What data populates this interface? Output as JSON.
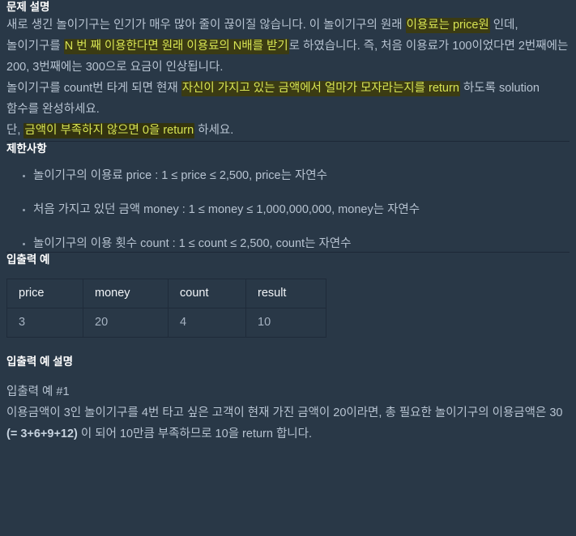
{
  "theme": {
    "background": "#293847",
    "body_text": "#b7c3d1",
    "heading_text": "#ffffff",
    "highlight_bg": "#3b3b13",
    "highlight_text": "#d7e453",
    "divider": "#1d2836",
    "table_border": "#1f2b3a",
    "table_header_text": "#f2f5f8",
    "table_cell_text": "#a5b2c1"
  },
  "problem": {
    "heading": "문제 설명",
    "intro": {
      "seg1": "새로 생긴 놀이기구는 인기가 매우 많아 줄이 끊이질 않습니다. 이 놀이기구의 원래 ",
      "hl1": "이용료는 price원",
      "seg2": " 인데, 놀이기구를 ",
      "hl2": "N 번 째 이용한다면 원래 이용료의 N배를 받기",
      "seg3": "로 하였습니다. 즉, 처음 이용료가 100이었다면 2번째에는 200, 3번째에는 300으로 요금이 인상됩니다."
    },
    "solution": {
      "seg1": "놀이기구를 count번 타게 되면 현재 ",
      "hl1": "자신이 가지고 있는 금액에서 얼마가 모자라는지를 return",
      "seg2": " 하도록 solution 함수를 완성하세요."
    },
    "note": {
      "seg1": "단, ",
      "hl1": "금액이 부족하지 않으면 0을 return",
      "seg2": " 하세요."
    }
  },
  "limits": {
    "heading": "제한사항",
    "items": [
      "놀이기구의 이용료 price : 1 ≤ price ≤ 2,500, price는 자연수",
      "처음 가지고 있던 금액 money : 1 ≤ money ≤ 1,000,000,000, money는 자연수",
      "놀이기구의 이용 횟수 count : 1 ≤ count ≤ 2,500, count는 자연수"
    ]
  },
  "io_example": {
    "heading": "입출력 예",
    "columns": [
      "price",
      "money",
      "count",
      "result"
    ],
    "rows": [
      [
        "3",
        "20",
        "4",
        "10"
      ]
    ]
  },
  "io_explanation": {
    "heading": "입출력 예 설명",
    "case_label": "입출력 예 #1",
    "case_body": {
      "seg1": "이용금액이 3인 놀이기구를 4번 타고 싶은 고객이 현재 가진 금액이 20이라면, 총 필요한 놀이기구의 이용금액은 30 ",
      "bold": "(= 3+6+9+12)",
      "seg2": " 이 되어 10만큼 부족하므로 10을 return 합니다."
    }
  }
}
